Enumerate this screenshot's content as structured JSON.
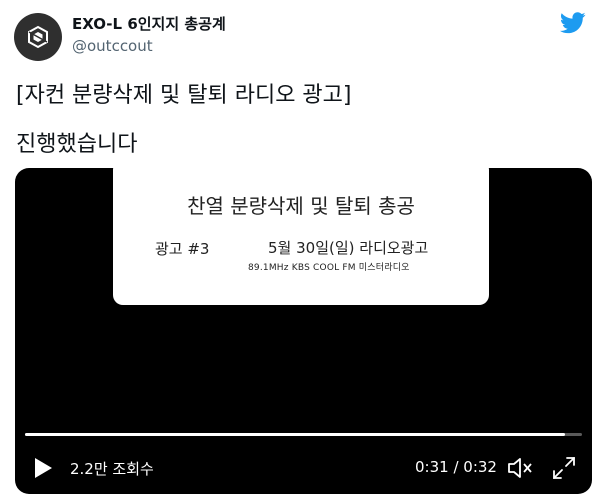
{
  "account": {
    "display_name": "EXO-L 6인지지 총공계",
    "handle": "@outccout",
    "avatar_icon": "exo-logo-icon",
    "brand_icon": "twitter-bird-icon",
    "brand_color": "#1d9bf0"
  },
  "tweet": {
    "line1": "[자컨 분량삭제 및 탈퇴 라디오 광고]",
    "line2": "진행했습니다"
  },
  "video": {
    "card": {
      "title": "찬열 분량삭제 및 탈퇴 총공",
      "ad_number": "광고 #3",
      "date": "5월 30일(일) 라디오광고",
      "station": "89.1MHz   KBS COOL FM    미스터라디오"
    },
    "progress_fraction": 0.97,
    "views": "2.2만 조회수",
    "time": "0:31 / 0:32",
    "play_icon": "play-icon",
    "volume_icon": "volume-muted-icon",
    "fullscreen_icon": "fullscreen-icon"
  }
}
